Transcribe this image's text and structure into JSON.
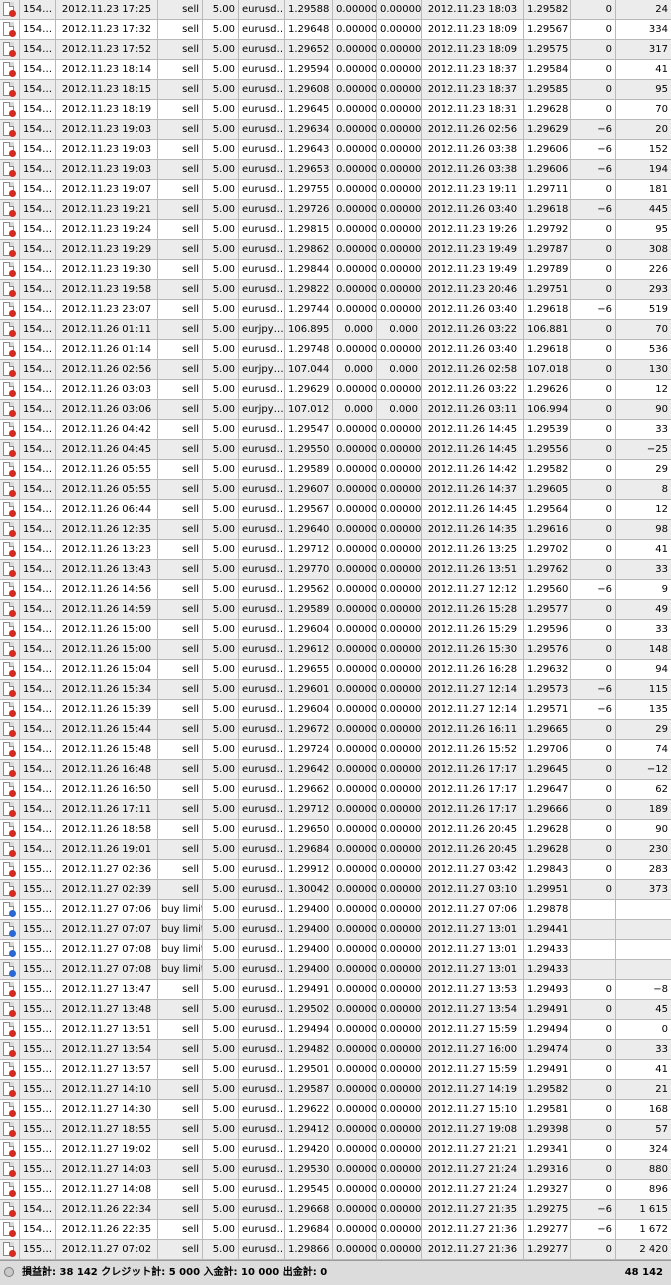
{
  "rows": [
    [
      "154…",
      "2012.11.23 17:25",
      "sell",
      "5.00",
      "eurusd…",
      "1.29588",
      "0.00000",
      "0.00000",
      "2012.11.23 18:03",
      "1.29582",
      "0",
      "24"
    ],
    [
      "154…",
      "2012.11.23 17:32",
      "sell",
      "5.00",
      "eurusd…",
      "1.29648",
      "0.00000",
      "0.00000",
      "2012.11.23 18:09",
      "1.29567",
      "0",
      "334"
    ],
    [
      "154…",
      "2012.11.23 17:52",
      "sell",
      "5.00",
      "eurusd…",
      "1.29652",
      "0.00000",
      "0.00000",
      "2012.11.23 18:09",
      "1.29575",
      "0",
      "317"
    ],
    [
      "154…",
      "2012.11.23 18:14",
      "sell",
      "5.00",
      "eurusd…",
      "1.29594",
      "0.00000",
      "0.00000",
      "2012.11.23 18:37",
      "1.29584",
      "0",
      "41"
    ],
    [
      "154…",
      "2012.11.23 18:15",
      "sell",
      "5.00",
      "eurusd…",
      "1.29608",
      "0.00000",
      "0.00000",
      "2012.11.23 18:37",
      "1.29585",
      "0",
      "95"
    ],
    [
      "154…",
      "2012.11.23 18:19",
      "sell",
      "5.00",
      "eurusd…",
      "1.29645",
      "0.00000",
      "0.00000",
      "2012.11.23 18:31",
      "1.29628",
      "0",
      "70"
    ],
    [
      "154…",
      "2012.11.23 19:03",
      "sell",
      "5.00",
      "eurusd…",
      "1.29634",
      "0.00000",
      "0.00000",
      "2012.11.26 02:56",
      "1.29629",
      "−6",
      "20"
    ],
    [
      "154…",
      "2012.11.23 19:03",
      "sell",
      "5.00",
      "eurusd…",
      "1.29643",
      "0.00000",
      "0.00000",
      "2012.11.26 03:38",
      "1.29606",
      "−6",
      "152"
    ],
    [
      "154…",
      "2012.11.23 19:03",
      "sell",
      "5.00",
      "eurusd…",
      "1.29653",
      "0.00000",
      "0.00000",
      "2012.11.26 03:38",
      "1.29606",
      "−6",
      "194"
    ],
    [
      "154…",
      "2012.11.23 19:07",
      "sell",
      "5.00",
      "eurusd…",
      "1.29755",
      "0.00000",
      "0.00000",
      "2012.11.23 19:11",
      "1.29711",
      "0",
      "181"
    ],
    [
      "154…",
      "2012.11.23 19:21",
      "sell",
      "5.00",
      "eurusd…",
      "1.29726",
      "0.00000",
      "0.00000",
      "2012.11.26 03:40",
      "1.29618",
      "−6",
      "445"
    ],
    [
      "154…",
      "2012.11.23 19:24",
      "sell",
      "5.00",
      "eurusd…",
      "1.29815",
      "0.00000",
      "0.00000",
      "2012.11.23 19:26",
      "1.29792",
      "0",
      "95"
    ],
    [
      "154…",
      "2012.11.23 19:29",
      "sell",
      "5.00",
      "eurusd…",
      "1.29862",
      "0.00000",
      "0.00000",
      "2012.11.23 19:49",
      "1.29787",
      "0",
      "308"
    ],
    [
      "154…",
      "2012.11.23 19:30",
      "sell",
      "5.00",
      "eurusd…",
      "1.29844",
      "0.00000",
      "0.00000",
      "2012.11.23 19:49",
      "1.29789",
      "0",
      "226"
    ],
    [
      "154…",
      "2012.11.23 19:58",
      "sell",
      "5.00",
      "eurusd…",
      "1.29822",
      "0.00000",
      "0.00000",
      "2012.11.23 20:46",
      "1.29751",
      "0",
      "293"
    ],
    [
      "154…",
      "2012.11.23 23:07",
      "sell",
      "5.00",
      "eurusd…",
      "1.29744",
      "0.00000",
      "0.00000",
      "2012.11.26 03:40",
      "1.29618",
      "−6",
      "519"
    ],
    [
      "154…",
      "2012.11.26 01:11",
      "sell",
      "5.00",
      "eurjpy…",
      "106.895",
      "0.000",
      "0.000",
      "2012.11.26 03:22",
      "106.881",
      "0",
      "70"
    ],
    [
      "154…",
      "2012.11.26 01:14",
      "sell",
      "5.00",
      "eurusd…",
      "1.29748",
      "0.00000",
      "0.00000",
      "2012.11.26 03:40",
      "1.29618",
      "0",
      "536"
    ],
    [
      "154…",
      "2012.11.26 02:56",
      "sell",
      "5.00",
      "eurjpy…",
      "107.044",
      "0.000",
      "0.000",
      "2012.11.26 02:58",
      "107.018",
      "0",
      "130"
    ],
    [
      "154…",
      "2012.11.26 03:03",
      "sell",
      "5.00",
      "eurusd…",
      "1.29629",
      "0.00000",
      "0.00000",
      "2012.11.26 03:22",
      "1.29626",
      "0",
      "12"
    ],
    [
      "154…",
      "2012.11.26 03:06",
      "sell",
      "5.00",
      "eurjpy…",
      "107.012",
      "0.000",
      "0.000",
      "2012.11.26 03:11",
      "106.994",
      "0",
      "90"
    ],
    [
      "154…",
      "2012.11.26 04:42",
      "sell",
      "5.00",
      "eurusd…",
      "1.29547",
      "0.00000",
      "0.00000",
      "2012.11.26 14:45",
      "1.29539",
      "0",
      "33"
    ],
    [
      "154…",
      "2012.11.26 04:45",
      "sell",
      "5.00",
      "eurusd…",
      "1.29550",
      "0.00000",
      "0.00000",
      "2012.11.26 14:45",
      "1.29556",
      "0",
      "−25"
    ],
    [
      "154…",
      "2012.11.26 05:55",
      "sell",
      "5.00",
      "eurusd…",
      "1.29589",
      "0.00000",
      "0.00000",
      "2012.11.26 14:42",
      "1.29582",
      "0",
      "29"
    ],
    [
      "154…",
      "2012.11.26 05:55",
      "sell",
      "5.00",
      "eurusd…",
      "1.29607",
      "0.00000",
      "0.00000",
      "2012.11.26 14:37",
      "1.29605",
      "0",
      "8"
    ],
    [
      "154…",
      "2012.11.26 06:44",
      "sell",
      "5.00",
      "eurusd…",
      "1.29567",
      "0.00000",
      "0.00000",
      "2012.11.26 14:45",
      "1.29564",
      "0",
      "12"
    ],
    [
      "154…",
      "2012.11.26 12:35",
      "sell",
      "5.00",
      "eurusd…",
      "1.29640",
      "0.00000",
      "0.00000",
      "2012.11.26 14:35",
      "1.29616",
      "0",
      "98"
    ],
    [
      "154…",
      "2012.11.26 13:23",
      "sell",
      "5.00",
      "eurusd…",
      "1.29712",
      "0.00000",
      "0.00000",
      "2012.11.26 13:25",
      "1.29702",
      "0",
      "41"
    ],
    [
      "154…",
      "2012.11.26 13:43",
      "sell",
      "5.00",
      "eurusd…",
      "1.29770",
      "0.00000",
      "0.00000",
      "2012.11.26 13:51",
      "1.29762",
      "0",
      "33"
    ],
    [
      "154…",
      "2012.11.26 14:56",
      "sell",
      "5.00",
      "eurusd…",
      "1.29562",
      "0.00000",
      "0.00000",
      "2012.11.27 12:12",
      "1.29560",
      "−6",
      "9"
    ],
    [
      "154…",
      "2012.11.26 14:59",
      "sell",
      "5.00",
      "eurusd…",
      "1.29589",
      "0.00000",
      "0.00000",
      "2012.11.26 15:28",
      "1.29577",
      "0",
      "49"
    ],
    [
      "154…",
      "2012.11.26 15:00",
      "sell",
      "5.00",
      "eurusd…",
      "1.29604",
      "0.00000",
      "0.00000",
      "2012.11.26 15:29",
      "1.29596",
      "0",
      "33"
    ],
    [
      "154…",
      "2012.11.26 15:00",
      "sell",
      "5.00",
      "eurusd…",
      "1.29612",
      "0.00000",
      "0.00000",
      "2012.11.26 15:30",
      "1.29576",
      "0",
      "148"
    ],
    [
      "154…",
      "2012.11.26 15:04",
      "sell",
      "5.00",
      "eurusd…",
      "1.29655",
      "0.00000",
      "0.00000",
      "2012.11.26 16:28",
      "1.29632",
      "0",
      "94"
    ],
    [
      "154…",
      "2012.11.26 15:34",
      "sell",
      "5.00",
      "eurusd…",
      "1.29601",
      "0.00000",
      "0.00000",
      "2012.11.27 12:14",
      "1.29573",
      "−6",
      "115"
    ],
    [
      "154…",
      "2012.11.26 15:39",
      "sell",
      "5.00",
      "eurusd…",
      "1.29604",
      "0.00000",
      "0.00000",
      "2012.11.27 12:14",
      "1.29571",
      "−6",
      "135"
    ],
    [
      "154…",
      "2012.11.26 15:44",
      "sell",
      "5.00",
      "eurusd…",
      "1.29672",
      "0.00000",
      "0.00000",
      "2012.11.26 16:11",
      "1.29665",
      "0",
      "29"
    ],
    [
      "154…",
      "2012.11.26 15:48",
      "sell",
      "5.00",
      "eurusd…",
      "1.29724",
      "0.00000",
      "0.00000",
      "2012.11.26 15:52",
      "1.29706",
      "0",
      "74"
    ],
    [
      "154…",
      "2012.11.26 16:48",
      "sell",
      "5.00",
      "eurusd…",
      "1.29642",
      "0.00000",
      "0.00000",
      "2012.11.26 17:17",
      "1.29645",
      "0",
      "−12"
    ],
    [
      "154…",
      "2012.11.26 16:50",
      "sell",
      "5.00",
      "eurusd…",
      "1.29662",
      "0.00000",
      "0.00000",
      "2012.11.26 17:17",
      "1.29647",
      "0",
      "62"
    ],
    [
      "154…",
      "2012.11.26 17:11",
      "sell",
      "5.00",
      "eurusd…",
      "1.29712",
      "0.00000",
      "0.00000",
      "2012.11.26 17:17",
      "1.29666",
      "0",
      "189"
    ],
    [
      "154…",
      "2012.11.26 18:58",
      "sell",
      "5.00",
      "eurusd…",
      "1.29650",
      "0.00000",
      "0.00000",
      "2012.11.26 20:45",
      "1.29628",
      "0",
      "90"
    ],
    [
      "154…",
      "2012.11.26 19:01",
      "sell",
      "5.00",
      "eurusd…",
      "1.29684",
      "0.00000",
      "0.00000",
      "2012.11.26 20:45",
      "1.29628",
      "0",
      "230"
    ],
    [
      "155…",
      "2012.11.27 02:36",
      "sell",
      "5.00",
      "eurusd…",
      "1.29912",
      "0.00000",
      "0.00000",
      "2012.11.27 03:42",
      "1.29843",
      "0",
      "283"
    ],
    [
      "155…",
      "2012.11.27 02:39",
      "sell",
      "5.00",
      "eurusd…",
      "1.30042",
      "0.00000",
      "0.00000",
      "2012.11.27 03:10",
      "1.29951",
      "0",
      "373"
    ],
    [
      "155…",
      "2012.11.27 07:06",
      "buy limit",
      "5.00",
      "eurusd…",
      "1.29400",
      "0.00000",
      "0.00000",
      "2012.11.27 07:06",
      "1.29878",
      "",
      ""
    ],
    [
      "155…",
      "2012.11.27 07:07",
      "buy limit",
      "5.00",
      "eurusd…",
      "1.29400",
      "0.00000",
      "0.00000",
      "2012.11.27 13:01",
      "1.29441",
      "",
      ""
    ],
    [
      "155…",
      "2012.11.27 07:08",
      "buy limit",
      "5.00",
      "eurusd…",
      "1.29400",
      "0.00000",
      "0.00000",
      "2012.11.27 13:01",
      "1.29433",
      "",
      ""
    ],
    [
      "155…",
      "2012.11.27 07:08",
      "buy limit",
      "5.00",
      "eurusd…",
      "1.29400",
      "0.00000",
      "0.00000",
      "2012.11.27 13:01",
      "1.29433",
      "",
      ""
    ],
    [
      "155…",
      "2012.11.27 13:47",
      "sell",
      "5.00",
      "eurusd…",
      "1.29491",
      "0.00000",
      "0.00000",
      "2012.11.27 13:53",
      "1.29493",
      "0",
      "−8"
    ],
    [
      "155…",
      "2012.11.27 13:48",
      "sell",
      "5.00",
      "eurusd…",
      "1.29502",
      "0.00000",
      "0.00000",
      "2012.11.27 13:54",
      "1.29491",
      "0",
      "45"
    ],
    [
      "155…",
      "2012.11.27 13:51",
      "sell",
      "5.00",
      "eurusd…",
      "1.29494",
      "0.00000",
      "0.00000",
      "2012.11.27 15:59",
      "1.29494",
      "0",
      "0"
    ],
    [
      "155…",
      "2012.11.27 13:54",
      "sell",
      "5.00",
      "eurusd…",
      "1.29482",
      "0.00000",
      "0.00000",
      "2012.11.27 16:00",
      "1.29474",
      "0",
      "33"
    ],
    [
      "155…",
      "2012.11.27 13:57",
      "sell",
      "5.00",
      "eurusd…",
      "1.29501",
      "0.00000",
      "0.00000",
      "2012.11.27 15:59",
      "1.29491",
      "0",
      "41"
    ],
    [
      "155…",
      "2012.11.27 14:10",
      "sell",
      "5.00",
      "eurusd…",
      "1.29587",
      "0.00000",
      "0.00000",
      "2012.11.27 14:19",
      "1.29582",
      "0",
      "21"
    ],
    [
      "155…",
      "2012.11.27 14:30",
      "sell",
      "5.00",
      "eurusd…",
      "1.29622",
      "0.00000",
      "0.00000",
      "2012.11.27 15:10",
      "1.29581",
      "0",
      "168"
    ],
    [
      "155…",
      "2012.11.27 18:55",
      "sell",
      "5.00",
      "eurusd…",
      "1.29412",
      "0.00000",
      "0.00000",
      "2012.11.27 19:08",
      "1.29398",
      "0",
      "57"
    ],
    [
      "155…",
      "2012.11.27 19:02",
      "sell",
      "5.00",
      "eurusd…",
      "1.29420",
      "0.00000",
      "0.00000",
      "2012.11.27 21:21",
      "1.29341",
      "0",
      "324"
    ],
    [
      "155…",
      "2012.11.27 14:03",
      "sell",
      "5.00",
      "eurusd…",
      "1.29530",
      "0.00000",
      "0.00000",
      "2012.11.27 21:24",
      "1.29316",
      "0",
      "880"
    ],
    [
      "155…",
      "2012.11.27 14:08",
      "sell",
      "5.00",
      "eurusd…",
      "1.29545",
      "0.00000",
      "0.00000",
      "2012.11.27 21:24",
      "1.29327",
      "0",
      "896"
    ],
    [
      "154…",
      "2012.11.26 22:34",
      "sell",
      "5.00",
      "eurusd…",
      "1.29668",
      "0.00000",
      "0.00000",
      "2012.11.27 21:35",
      "1.29275",
      "−6",
      "1 615"
    ],
    [
      "154…",
      "2012.11.26 22:35",
      "sell",
      "5.00",
      "eurusd…",
      "1.29684",
      "0.00000",
      "0.00000",
      "2012.11.27 21:36",
      "1.29277",
      "−6",
      "1 672"
    ],
    [
      "155…",
      "2012.11.27 07:02",
      "sell",
      "5.00",
      "eurusd…",
      "1.29866",
      "0.00000",
      "0.00000",
      "2012.11.27 21:36",
      "1.29277",
      "0",
      "2 420"
    ]
  ],
  "row_icons": {
    "sell": {
      "name": "sell-order-icon",
      "color": "#d42a1f"
    },
    "buy limit": {
      "name": "buy-limit-order-icon",
      "color": "#2a69d4"
    }
  },
  "colors": {
    "row_odd": "#ececec",
    "row_even": "#ffffff",
    "grid_line": "#b9b9b9",
    "status_bar": "#dcdcdc"
  },
  "status": {
    "summary": "損益計: 38 142  クレジット計: 5 000  入金計: 10 000  出金計: 0",
    "total": "48 142"
  }
}
